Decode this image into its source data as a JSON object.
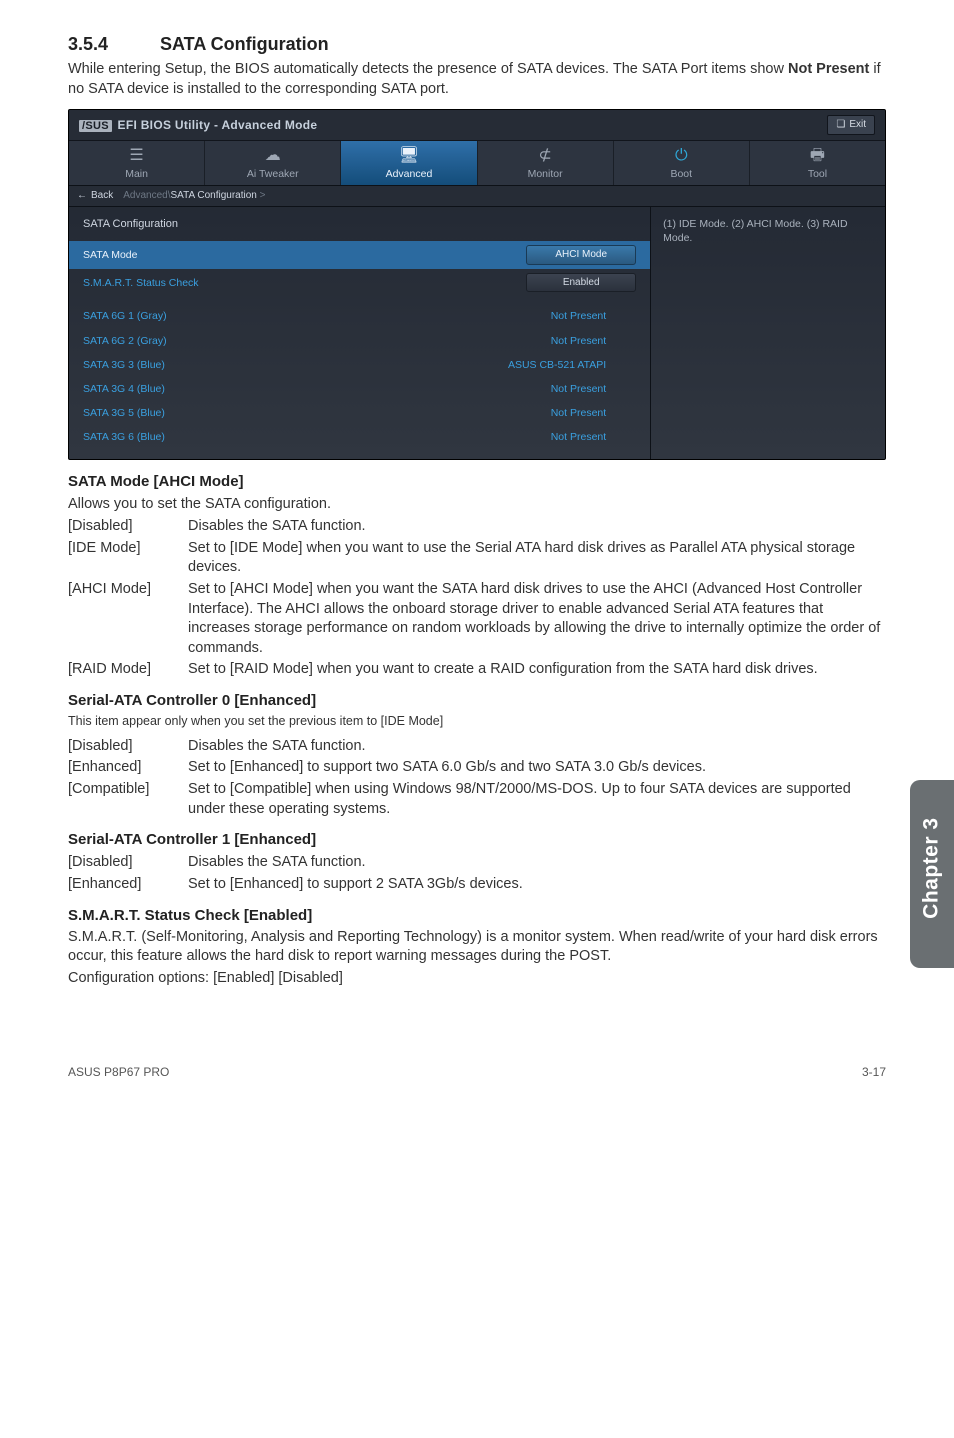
{
  "section": {
    "number": "3.5.4",
    "title": "SATA Configuration"
  },
  "intro_a": "While entering Setup, the BIOS automatically detects the presence of SATA devices. The SATA Port items show ",
  "intro_b": "Not Present",
  "intro_c": " if no SATA device is installed to the corresponding SATA port.",
  "bios": {
    "brand": "/SUS",
    "title": "EFI BIOS Utility - Advanced Mode",
    "exit": "Exit",
    "tabs": {
      "main": "Main",
      "tweaker": "Ai  Tweaker",
      "advanced": "Advanced",
      "monitor": "Monitor",
      "boot": "Boot",
      "tool": "Tool"
    },
    "back": "Back",
    "crumb_prefix": "Advanced\\",
    "crumb_item": "SATA Configuration",
    "crumb_suffix": " >",
    "cfg_title": "SATA Configuration",
    "mode_label": "SATA Mode",
    "mode_value": "AHCI Mode",
    "smart_label": "S.M.A.R.T. Status Check",
    "smart_value": "Enabled",
    "ports": [
      {
        "label": "SATA 6G 1 (Gray)",
        "value": "Not Present"
      },
      {
        "label": "SATA 6G 2 (Gray)",
        "value": "Not Present"
      },
      {
        "label": "SATA 3G 3 (Blue)",
        "value": "ASUS   CB-521 ATAPI"
      },
      {
        "label": "SATA 3G 4 (Blue)",
        "value": "Not Present"
      },
      {
        "label": "SATA 3G 5 (Blue)",
        "value": "Not Present"
      },
      {
        "label": "SATA 3G 6 (Blue)",
        "value": "Not Present"
      }
    ],
    "help": "(1) IDE Mode. (2) AHCI Mode. (3) RAID Mode."
  },
  "h_sata_mode": "SATA Mode [AHCI Mode]",
  "sata_mode_desc": "Allows you to set the SATA configuration.",
  "sata_mode_opts": [
    {
      "k": "[Disabled]",
      "v": "Disables the SATA function."
    },
    {
      "k": "[IDE Mode]",
      "v": "Set to [IDE Mode] when you want to use the Serial ATA hard disk drives as Parallel ATA physical storage devices."
    },
    {
      "k": "[AHCI Mode]",
      "v": "Set to [AHCI Mode] when you want the SATA hard disk drives to use the AHCI (Advanced Host Controller Interface). The AHCI allows the onboard storage driver to enable advanced Serial ATA features that increases storage performance on random workloads by allowing the drive to internally optimize the order of commands."
    },
    {
      "k": "[RAID Mode]",
      "v": "Set to [RAID Mode] when you want to create a RAID configuration from the SATA hard disk drives."
    }
  ],
  "h_ctrl0": "Serial-ATA Controller 0 [Enhanced]",
  "ctrl0_note": "This item appear only when you set the previous item to [IDE Mode]",
  "ctrl0_opts": [
    {
      "k": "[Disabled]",
      "v": "Disables the SATA function."
    },
    {
      "k": "[Enhanced]",
      "v": "Set to [Enhanced] to support two SATA 6.0 Gb/s and two SATA 3.0 Gb/s devices."
    },
    {
      "k": "[Compatible]",
      "v": "Set to [Compatible] when using Windows 98/NT/2000/MS-DOS. Up to four SATA devices are supported under these operating systems."
    }
  ],
  "h_ctrl1": "Serial-ATA Controller 1 [Enhanced]",
  "ctrl1_opts": [
    {
      "k": "[Disabled]",
      "v": "Disables the SATA function."
    },
    {
      "k": "[Enhanced]",
      "v": "Set to [Enhanced] to support 2 SATA 3Gb/s devices."
    }
  ],
  "h_smart": "S.M.A.R.T. Status Check [Enabled]",
  "smart_p1": "S.M.A.R.T. (Self-Monitoring, Analysis and Reporting Technology) is a monitor system. When read/write of your hard disk errors occur, this feature allows the hard disk to report warning messages during the POST.",
  "smart_p2": "Configuration options: [Enabled] [Disabled]",
  "side_tab": "Chapter 3",
  "footer": {
    "left": "ASUS P8P67 PRO",
    "right": "3-17"
  }
}
